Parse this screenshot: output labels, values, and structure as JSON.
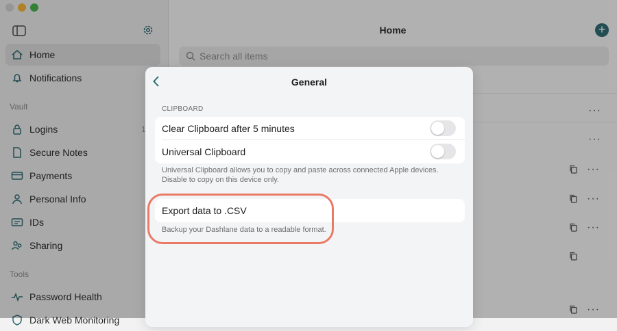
{
  "sidebar": {
    "items": [
      {
        "label": "Home",
        "icon": "house-icon"
      },
      {
        "label": "Notifications",
        "icon": "bell-icon"
      }
    ],
    "vault_heading": "Vault",
    "vault_items": [
      {
        "label": "Logins",
        "icon": "lock-icon"
      },
      {
        "label": "Secure Notes",
        "icon": "note-icon"
      },
      {
        "label": "Payments",
        "icon": "card-icon"
      },
      {
        "label": "Personal Info",
        "icon": "person-icon"
      },
      {
        "label": "IDs",
        "icon": "id-icon"
      },
      {
        "label": "Sharing",
        "icon": "people-icon"
      }
    ],
    "logins_count": "1",
    "tools_heading": "Tools",
    "tools_items": [
      {
        "label": "Password Health",
        "icon": "pulse-icon"
      },
      {
        "label": "Dark Web Monitoring",
        "icon": "shield-icon"
      }
    ]
  },
  "main": {
    "title": "Home",
    "search_placeholder": "Search all items"
  },
  "modal": {
    "title": "General",
    "clipboard_heading": "CLIPBOARD",
    "clear_clipboard_label": "Clear Clipboard after 5 minutes",
    "clear_clipboard_on": false,
    "universal_clipboard_label": "Universal Clipboard",
    "universal_clipboard_on": false,
    "universal_footnote": "Universal Clipboard allows you to copy and paste across connected Apple devices. Disable to copy on this device only.",
    "export_label": "Export data to .CSV",
    "export_footnote": "Backup your Dashlane data to a readable format."
  },
  "colors": {
    "accent": "#2e6b73",
    "highlight": "#ea7a66",
    "toggle_off": "#e6e6e8"
  }
}
